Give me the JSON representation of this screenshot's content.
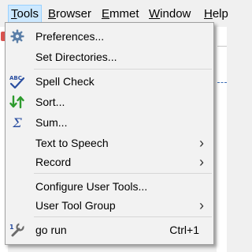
{
  "menubar": {
    "items": [
      {
        "label": "Tools",
        "underline": "T",
        "rest": "ools"
      },
      {
        "label": "Browser",
        "underline": "B",
        "rest": "rowser"
      },
      {
        "label": "Emmet",
        "underline": "E",
        "rest": "mmet"
      },
      {
        "label": "Window",
        "underline": "W",
        "rest": "indow"
      },
      {
        "label": "Help",
        "underline": "H",
        "rest": "elp"
      }
    ]
  },
  "menu": {
    "items": [
      {
        "label": "Preferences...",
        "icon": "gear-icon"
      },
      {
        "label": "Set Directories..."
      },
      {
        "label": "Spell Check",
        "icon": "spell-check-icon"
      },
      {
        "label": "Sort...",
        "icon": "sort-icon"
      },
      {
        "label": "Sum...",
        "icon": "sum-icon",
        "glyph": "Σ"
      },
      {
        "label": "Text to Speech",
        "arrow": ">"
      },
      {
        "label": "Record",
        "arrow": ">"
      },
      {
        "label": "Configure User Tools..."
      },
      {
        "label": "User Tool Group",
        "arrow": ">"
      },
      {
        "label": "go run",
        "icon": "tool-icon",
        "shortcut": "Ctrl+1"
      }
    ]
  },
  "colors": {
    "highlight": "#cce8ff",
    "highlight_border": "#99d1ff",
    "sigma": "#2a4ea0"
  }
}
